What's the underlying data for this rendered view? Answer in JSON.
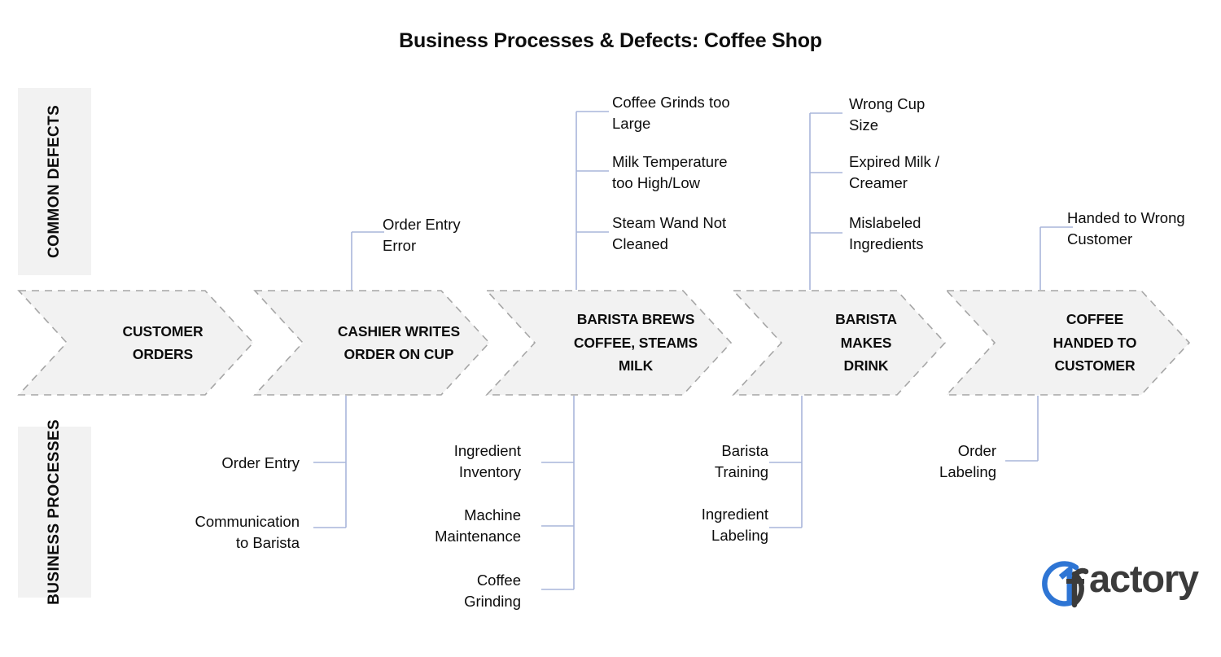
{
  "title": "Business Processes & Defects: Coffee Shop",
  "bands": {
    "defects": "COMMON\nDEFECTS",
    "processes": "BUSINESS\nPROCESSES"
  },
  "stages": [
    {
      "id": "customer-orders",
      "label": "CUSTOMER\nORDERS",
      "defects": [],
      "processes": []
    },
    {
      "id": "cashier-writes-order-on-cup",
      "label": "CASHIER WRITES\nORDER ON CUP",
      "defects": [
        "Order  Entry\nError"
      ],
      "processes": [
        "Order Entry",
        "Communication\nto Barista"
      ]
    },
    {
      "id": "barista-brews-coffee-steams-milk",
      "label": "BARISTA BREWS\nCOFFEE, STEAMS\nMILK",
      "defects": [
        "Coffee Grinds too\nLarge",
        "Milk Temperature\ntoo High/Low",
        "Steam Wand Not\nCleaned"
      ],
      "processes": [
        "Ingredient\nInventory",
        "Machine\nMaintenance",
        "Coffee\nGrinding"
      ]
    },
    {
      "id": "barista-makes-drink",
      "label": "BARISTA\nMAKES\nDRINK",
      "defects": [
        "Wrong Cup\nSize",
        "Expired Milk /\nCreamer",
        "Mislabeled\nIngredients"
      ],
      "processes": [
        "Barista\nTraining",
        "Ingredient\nLabeling"
      ]
    },
    {
      "id": "coffee-handed-to-customer",
      "label": "COFFEE\nHANDED TO\nCUSTOMER",
      "defects": [
        "Handed to Wrong\nCustomer"
      ],
      "processes": [
        "Order\nLabeling"
      ]
    }
  ],
  "logo": {
    "mark": "1f",
    "word": "actory",
    "brand_blue": "#2E75D4",
    "brand_dark": "#3b3b3b"
  },
  "colors": {
    "chevron_fill": "#F2F2F2",
    "chevron_border": "#A6A6A6",
    "band_fill": "#F2F2F2",
    "connector": "#A8B6DA",
    "text": "#0D0D0D"
  }
}
